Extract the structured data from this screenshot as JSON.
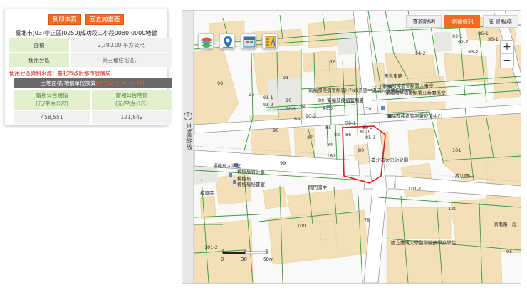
{
  "buttons": {
    "print": "列印本頁",
    "back": "回查詢畫面"
  },
  "parcel": {
    "title": "臺北市(03)中正區(0250)成功段三小段0080-0000地號"
  },
  "rows": [
    {
      "label": "面積",
      "value": "2,390.00 平方公尺"
    },
    {
      "label": "使用分區",
      "value": "第三種住宅區、"
    }
  ],
  "zone_source": "使用分區資料來源：臺北市政府都市發展局",
  "conversion": {
    "prefix": "土地面積/地價單位換算",
    "link": "(平方公尺 <－> 坪)"
  },
  "price": {
    "current_header": "當期公告現值\n(元/平方公尺)",
    "land_header": "當期公告地價\n(元/平方公尺)",
    "current_value": "458,551",
    "land_value": "121,849"
  },
  "map": {
    "zoom_label": "地圖縮放",
    "tabs": [
      "查詢說明",
      "地圖資訊",
      "街景服務"
    ],
    "active_tab": "地圖資訊",
    "zoom_in": "+",
    "zoom_out": "−",
    "scale": [
      "0",
      "30",
      "60m"
    ],
    "labels": {
      "lot_80": "80",
      "lot_80_1": "80-1",
      "lot_80_2": "80-2",
      "lot_79_1": "79-1",
      "lot_81": "81",
      "lot_82": "82",
      "lot_85": "85",
      "lot_86": "86",
      "lot_87": "87",
      "lot_89": "89",
      "lot_89_2": "89-2",
      "lot_90": "90",
      "lot_90_1": "90-1",
      "lot_92": "92",
      "lot_91": "91",
      "lot_91_1": "91-1",
      "lot_91_2": "91-2",
      "lot_97": "97",
      "lot_96": "96",
      "lot_99": "99",
      "lot_78": "78",
      "lot_79": "79",
      "lot_76": "76",
      "lot_94_2": "94-2",
      "lot_92_1": "92-1",
      "lot_92_7": "92-7",
      "lot_86_1": "86-1",
      "lot_93_1": "93-1",
      "lot_93_2": "93-2",
      "lot_101": "101",
      "lot_101_1": "101-1",
      "lot_100": "100",
      "lot_101_2": "101-2",
      "lot_120": "120",
      "lot_95": "95",
      "lot_98": "98",
      "lot_85_1": "85-1",
      "lot_84": "84",
      "lot_89_1": "89-1",
      "lot_90_2": "90-2",
      "bldg_1": "衛福部疾病管制署人事室",
      "bldg_2": "衛福部疾病管制署H7N9流感中央流行疫情指揮中心",
      "bldg_3": "衛福部疾病管制署公共關係室",
      "bldg_4": "衛福部疾病管制署",
      "bldg_5": "衛福部疾病管制署疫情中心",
      "school_1": "成功國中",
      "school_2": "國立臺灣大學醫學院藥學系學院",
      "kindergarten": "臺北市大忠幼兒園",
      "ctr_1": "標檢局人事室",
      "ctr_2": "標檢局會計室",
      "ctr_3": "標檢局秘書室",
      "ctr_4": "標檢局",
      "xiniu": "南門國中",
      "road_right": "濟南路一段",
      "road_top": "青島東路",
      "hosp_1": "校設區"
    }
  }
}
